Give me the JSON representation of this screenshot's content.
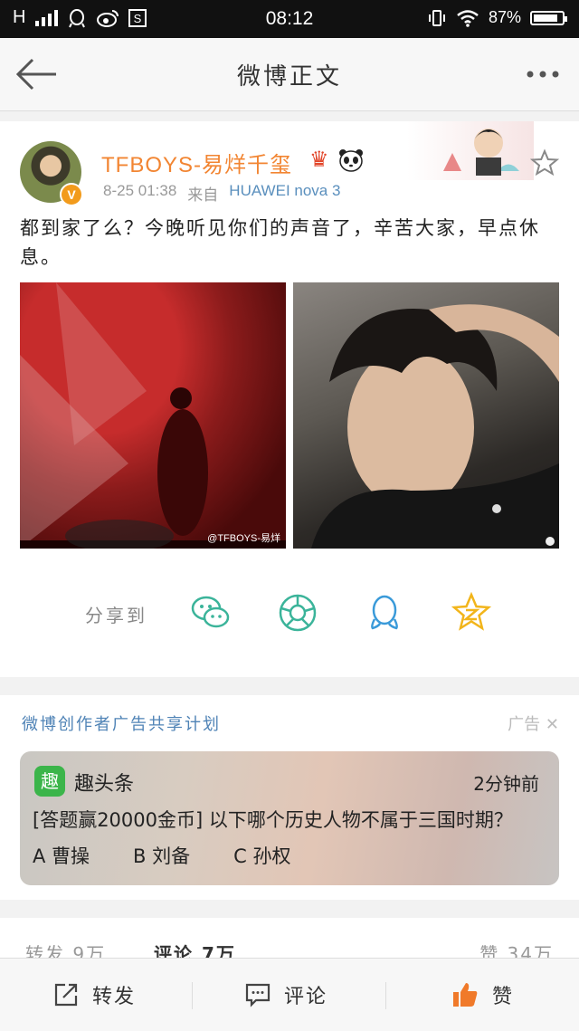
{
  "status_bar": {
    "signal": "H",
    "time": "08:12",
    "battery": "87%",
    "battery_level": 0.87
  },
  "nav": {
    "title": "微博正文"
  },
  "post": {
    "username": "TFBOYS-易烊千玺",
    "date": "8-25 01:38",
    "source_prefix": "来自",
    "device": "HUAWEI nova 3",
    "text": "都到家了么？今晚听见你们的声音了，辛苦大家，早点休息。",
    "watermark": "@TFBOYS-易烊"
  },
  "share": {
    "label": "分享到"
  },
  "ad": {
    "plan": "微博创作者广告共享计划",
    "tag": "广告",
    "logo_char": "趣",
    "brand": "趣头条",
    "time": "2分钟前",
    "question": "[答题赢20000金币] 以下哪个历史人物不属于三国时期？",
    "options": [
      "A 曹操",
      "B 刘备",
      "C 孙权"
    ]
  },
  "stats": {
    "repost": "转发 9万",
    "comment": "评论 7万",
    "like": "赞 34万"
  },
  "toolbar": {
    "repost": "转发",
    "comment": "评论",
    "like": "赞"
  },
  "colors": {
    "accent": "#f28532",
    "link": "#5a8fbd",
    "verified": "#f29b1c",
    "ad_logo": "#3bb54a",
    "like": "#f07a2a"
  }
}
